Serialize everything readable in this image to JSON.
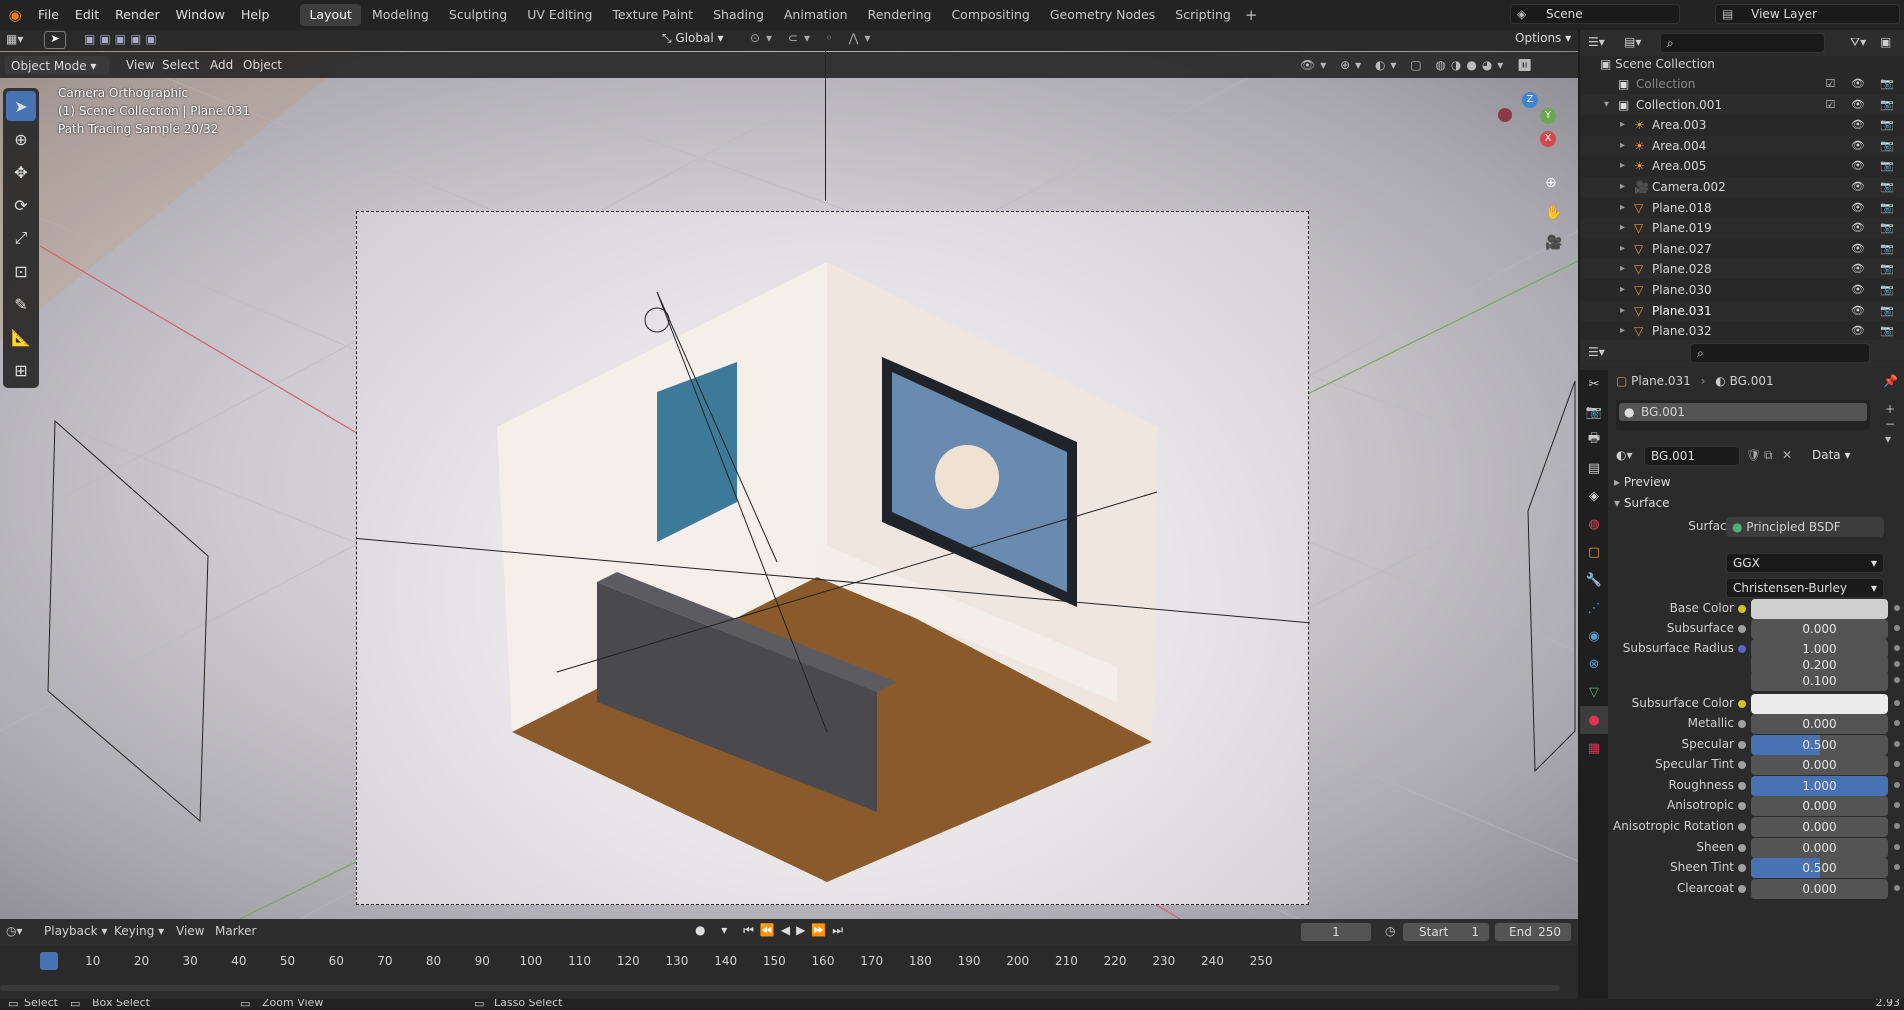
{
  "topbar": {
    "menus": [
      "File",
      "Edit",
      "Render",
      "Window",
      "Help"
    ],
    "workspaces": [
      "Layout",
      "Modeling",
      "Sculpting",
      "UV Editing",
      "Texture Paint",
      "Shading",
      "Animation",
      "Rendering",
      "Compositing",
      "Geometry Nodes",
      "Scripting"
    ],
    "active_workspace": "Layout",
    "scene": "Scene",
    "view_layer": "View Layer"
  },
  "viewport": {
    "mode": "Object Mode",
    "menus": [
      "View",
      "Select",
      "Add",
      "Object"
    ],
    "orientation": "Global",
    "options": "Options",
    "overlay_lines": [
      "Camera Orthographic",
      "(1) Scene Collection | Plane.031",
      "Path Tracing Sample 20/32"
    ],
    "gizmo_labels": [
      "Z",
      "Y",
      "X"
    ]
  },
  "outliner": {
    "root": "Scene Collection",
    "rows": [
      {
        "name": "Collection",
        "indent": 1,
        "icon": "collection-icon",
        "dim": true
      },
      {
        "name": "Collection.001",
        "indent": 1,
        "icon": "collection-icon"
      },
      {
        "name": "Area.003",
        "indent": 2,
        "icon": "light-icon"
      },
      {
        "name": "Area.004",
        "indent": 2,
        "icon": "light-icon"
      },
      {
        "name": "Area.005",
        "indent": 2,
        "icon": "light-icon"
      },
      {
        "name": "Camera.002",
        "indent": 2,
        "icon": "camera-icon"
      },
      {
        "name": "Plane.018",
        "indent": 2,
        "icon": "mesh-icon"
      },
      {
        "name": "Plane.019",
        "indent": 2,
        "icon": "mesh-icon"
      },
      {
        "name": "Plane.027",
        "indent": 2,
        "icon": "mesh-icon"
      },
      {
        "name": "Plane.028",
        "indent": 2,
        "icon": "mesh-icon"
      },
      {
        "name": "Plane.030",
        "indent": 2,
        "icon": "mesh-icon"
      },
      {
        "name": "Plane.031",
        "indent": 2,
        "icon": "mesh-icon",
        "selected": true
      },
      {
        "name": "Plane.032",
        "indent": 2,
        "icon": "mesh-icon"
      }
    ]
  },
  "properties": {
    "breadcrumb_object": "Plane.031",
    "breadcrumb_material": "BG.001",
    "slot": "BG.001",
    "material_name": "BG.001",
    "link": "Data",
    "panels": {
      "preview": "Preview",
      "surface": "Surface"
    },
    "surface_label": "Surface",
    "surface_shader": "Principled BSDF",
    "distribution": "GGX",
    "subsurface_method": "Christensen-Burley",
    "fields": [
      {
        "label": "Base Color",
        "type": "color",
        "dot": "yellow"
      },
      {
        "label": "Subsurface",
        "value": "0.000"
      },
      {
        "label": "Subsurface Radius",
        "value": "1.000",
        "dot": "blue"
      },
      {
        "label": "",
        "value": "0.200",
        "nodot": true
      },
      {
        "label": "",
        "value": "0.100",
        "nodot": true
      },
      {
        "label": "Subsurface Color",
        "type": "color2",
        "dot": "yellow"
      },
      {
        "label": "Metallic",
        "value": "0.000"
      },
      {
        "label": "Specular",
        "value": "0.500",
        "fill": 0.5
      },
      {
        "label": "Specular Tint",
        "value": "0.000"
      },
      {
        "label": "Roughness",
        "value": "1.000",
        "fill": 1.0
      },
      {
        "label": "Anisotropic",
        "value": "0.000"
      },
      {
        "label": "Anisotropic Rotation",
        "value": "0.000"
      },
      {
        "label": "Sheen",
        "value": "0.000"
      },
      {
        "label": "Sheen Tint",
        "value": "0.500",
        "fill": 0.5
      },
      {
        "label": "Clearcoat",
        "value": "0.000"
      }
    ]
  },
  "timeline": {
    "menus": [
      "Playback",
      "Keying",
      "View",
      "Marker"
    ],
    "current_frame": "1",
    "start_label": "Start",
    "start": "1",
    "end_label": "End",
    "end": "250",
    "ticks": [
      "1",
      "10",
      "20",
      "30",
      "40",
      "50",
      "60",
      "70",
      "80",
      "90",
      "100",
      "110",
      "120",
      "130",
      "140",
      "150",
      "160",
      "170",
      "180",
      "190",
      "200",
      "210",
      "220",
      "230",
      "240",
      "250"
    ]
  },
  "statusbar": {
    "items": [
      "Select",
      "Box Select",
      "Zoom View",
      "Lasso Select"
    ],
    "version": "2.93"
  }
}
